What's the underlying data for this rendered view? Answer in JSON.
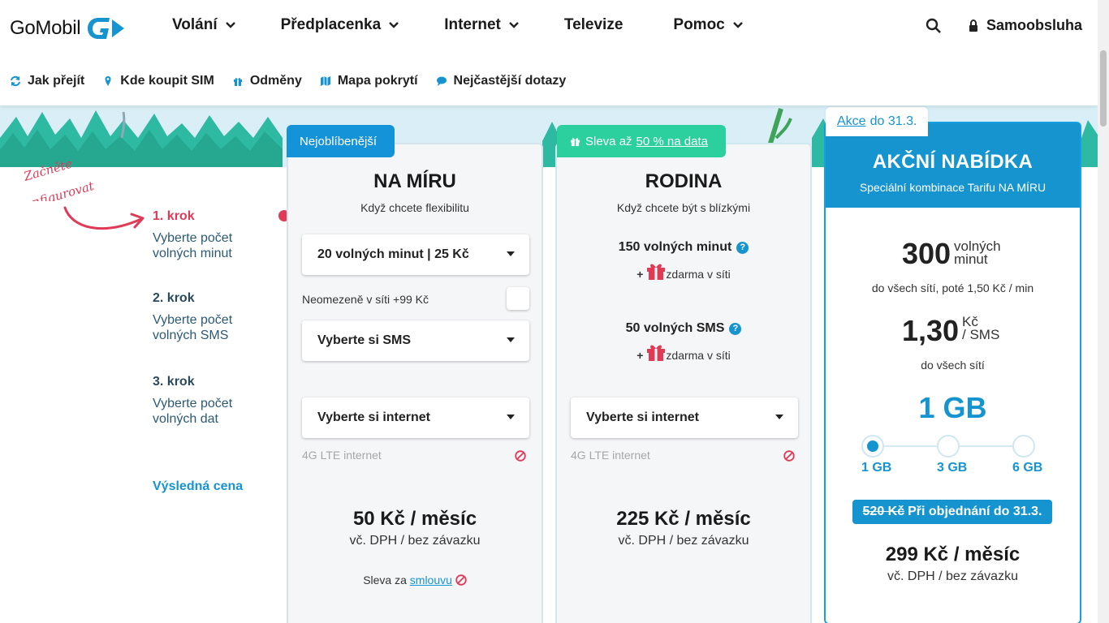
{
  "brand": {
    "name": "GoMobil"
  },
  "nav": {
    "items": [
      {
        "label": "Volání",
        "has_menu": true
      },
      {
        "label": "Předplacenka",
        "has_menu": true
      },
      {
        "label": "Internet",
        "has_menu": true
      },
      {
        "label": "Televize",
        "has_menu": false
      },
      {
        "label": "Pomoc",
        "has_menu": true
      }
    ],
    "selfcare_label": "Samoobsluha"
  },
  "subnav": {
    "items": [
      {
        "label": "Jak přejít",
        "icon": "refresh-icon"
      },
      {
        "label": "Kde koupit SIM",
        "icon": "map-pin-icon"
      },
      {
        "label": "Odměny",
        "icon": "gift-icon"
      },
      {
        "label": "Mapa pokrytí",
        "icon": "map-icon"
      },
      {
        "label": "Nejčastější dotazy",
        "icon": "chat-icon"
      }
    ]
  },
  "hint": {
    "line1": "Začněte",
    "line2": "konfigurovat"
  },
  "steps": [
    {
      "title": "1. krok",
      "desc1": "Vyberte počet",
      "desc2": "volných minut"
    },
    {
      "title": "2. krok",
      "desc1": "Vyberte počet",
      "desc2": "volných SMS"
    },
    {
      "title": "3. krok",
      "desc1": "Vyberte počet",
      "desc2": "volných dat"
    }
  ],
  "final_price_label": "Výsledná cena",
  "card_na_miru": {
    "tag": "Nejoblíbenější",
    "title": "NA MÍRU",
    "subtitle": "Když chcete flexibilitu",
    "minutes_select": "20 volných minut | 25 Kč",
    "unlimited_label": "Neomezeně v síti +99 Kč",
    "sms_select": "Vyberte si SMS",
    "internet_select": "Vyberte si internet",
    "lte_label": "4G LTE internet",
    "price": "50 Kč / měsíc",
    "vat": "vč. DPH / bez závazku",
    "contract_prefix": "Sleva za",
    "contract_link": "smlouvu"
  },
  "card_rodina": {
    "tag_prefix": "Sleva až",
    "tag_link": "50 % na data",
    "title": "RODINA",
    "subtitle": "Když chcete být s blízkými",
    "minutes": "150 volných minut",
    "sms": "50 volných SMS",
    "plus": "+",
    "free_in_network": "zdarma v síti",
    "internet_select": "Vyberte si internet",
    "lte_label": "4G LTE internet",
    "price": "225 Kč / měsíc",
    "vat": "vč. DPH / bez závazku"
  },
  "card_akce": {
    "tag_link": "Akce",
    "tag_rest": "do 31.3.",
    "title": "AKČNÍ NABÍDKA",
    "subtitle": "Speciální kombinace Tarifu NA MÍRU",
    "minutes_num": "300",
    "minutes_unit1": "volných",
    "minutes_unit2": "minut",
    "minutes_note": "do všech sítí, poté 1,50 Kč / min",
    "sms_num": "1,30",
    "sms_unit1": "Kč",
    "sms_unit2": "/ SMS",
    "sms_note": "do všech sítí",
    "data_amount": "1 GB",
    "data_options": [
      "1 GB",
      "3 GB",
      "6 GB"
    ],
    "selected_data_option": "1 GB",
    "old_price": "520 Kč",
    "promo_text": "Při objednání do 31.3.",
    "price": "299 Kč / měsíc",
    "vat": "vč. DPH / bez závazku"
  },
  "colors": {
    "accent_blue": "#1694d0",
    "accent_red": "#e03a56",
    "accent_green": "#2bd09e"
  }
}
